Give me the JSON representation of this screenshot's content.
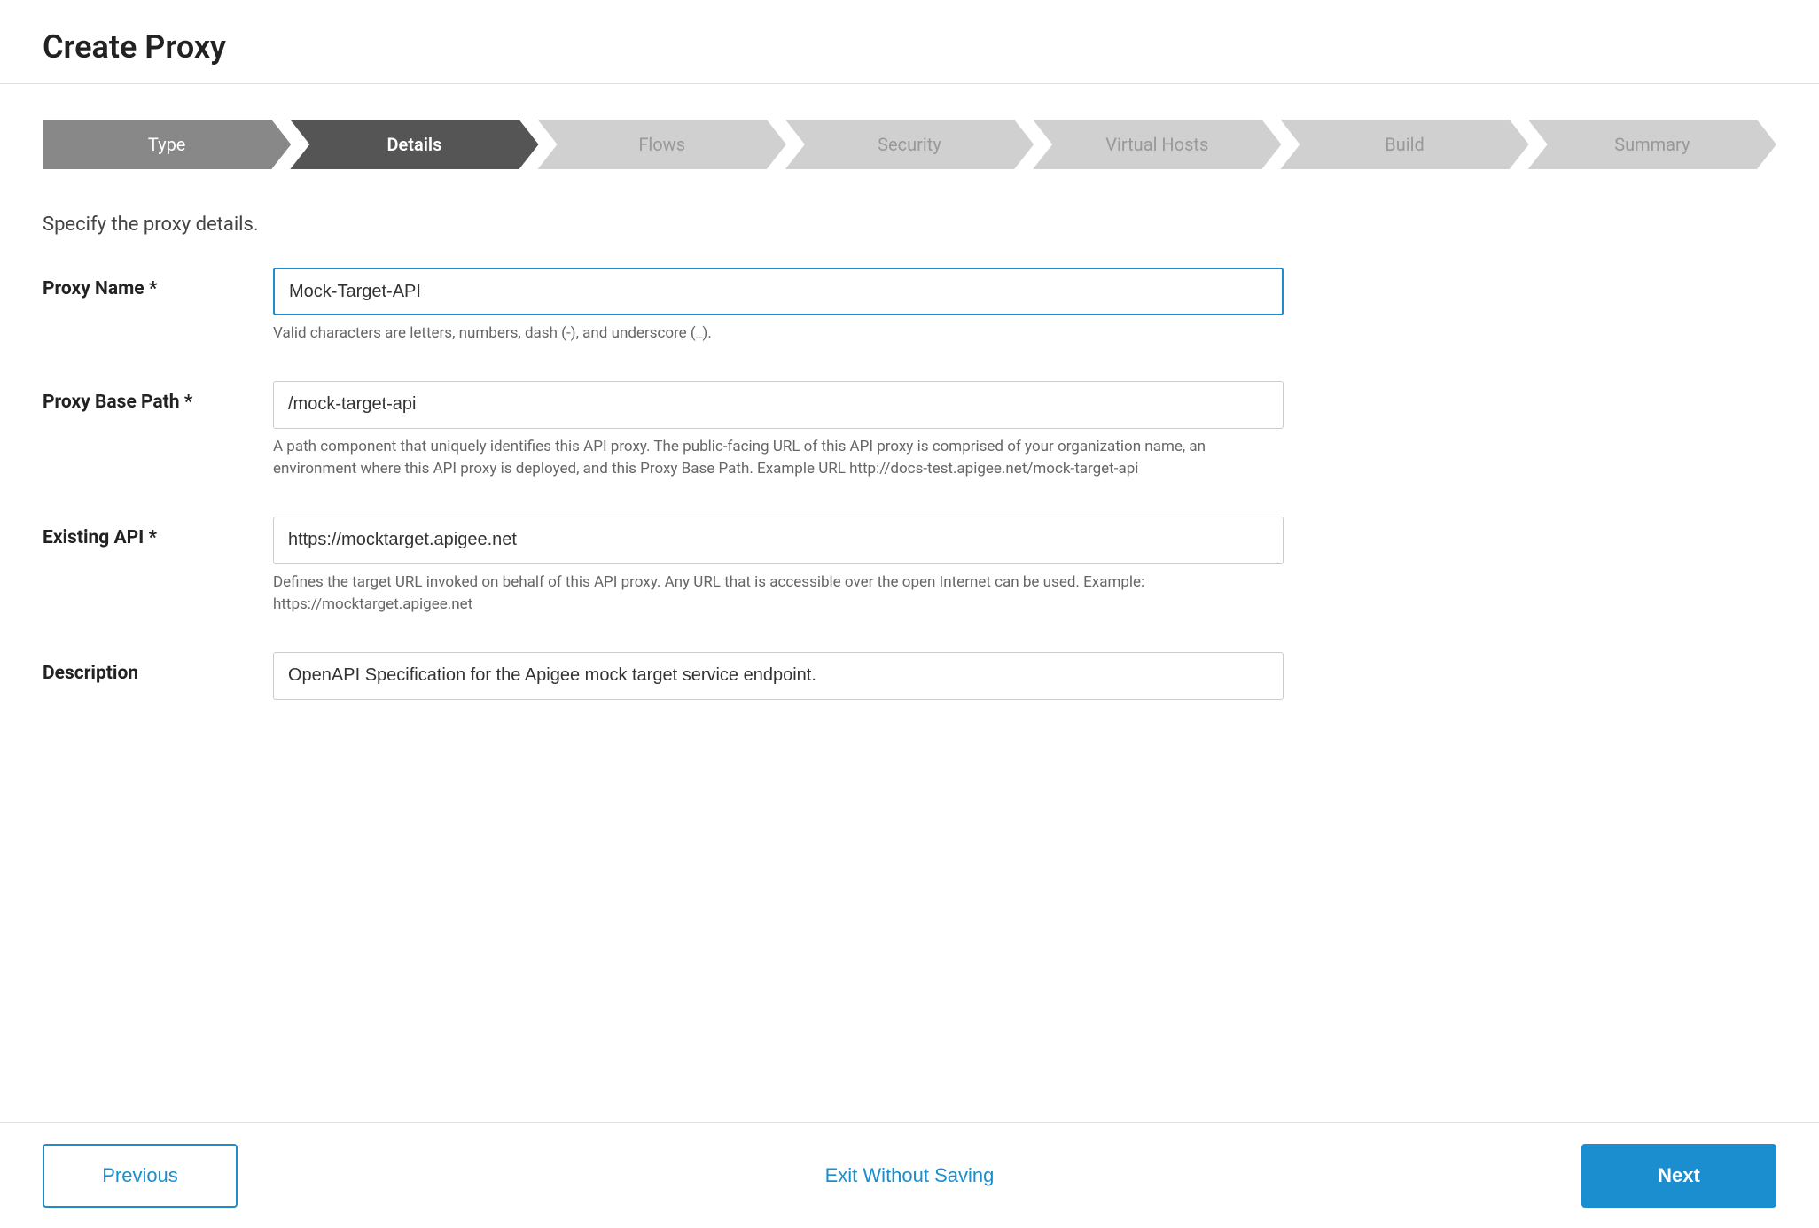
{
  "page": {
    "title": "Create Proxy"
  },
  "stepper": {
    "steps": [
      {
        "id": "type",
        "label": "Type",
        "state": "completed"
      },
      {
        "id": "details",
        "label": "Details",
        "state": "active"
      },
      {
        "id": "flows",
        "label": "Flows",
        "state": "inactive"
      },
      {
        "id": "security",
        "label": "Security",
        "state": "inactive"
      },
      {
        "id": "virtual-hosts",
        "label": "Virtual Hosts",
        "state": "inactive"
      },
      {
        "id": "build",
        "label": "Build",
        "state": "inactive"
      },
      {
        "id": "summary",
        "label": "Summary",
        "state": "inactive"
      }
    ]
  },
  "form": {
    "section_description": "Specify the proxy details.",
    "proxy_name": {
      "label": "Proxy Name *",
      "value": "Mock-Target-API",
      "hint": "Valid characters are letters, numbers, dash (-), and underscore (_)."
    },
    "proxy_base_path": {
      "label": "Proxy Base Path *",
      "value": "/mock-target-api",
      "hint": "A path component that uniquely identifies this API proxy. The public-facing URL of this API proxy is comprised of your organization name, an environment where this API proxy is deployed, and this Proxy Base Path. Example URL http://docs-test.apigee.net/mock-target-api"
    },
    "existing_api": {
      "label": "Existing API *",
      "value": "https://mocktarget.apigee.net",
      "hint": "Defines the target URL invoked on behalf of this API proxy. Any URL that is accessible over the open Internet can be used. Example: https://mocktarget.apigee.net"
    },
    "description": {
      "label": "Description",
      "value": "OpenAPI Specification for the Apigee mock target service endpoint.",
      "hint": ""
    }
  },
  "footer": {
    "previous_label": "Previous",
    "exit_label": "Exit Without Saving",
    "next_label": "Next"
  }
}
